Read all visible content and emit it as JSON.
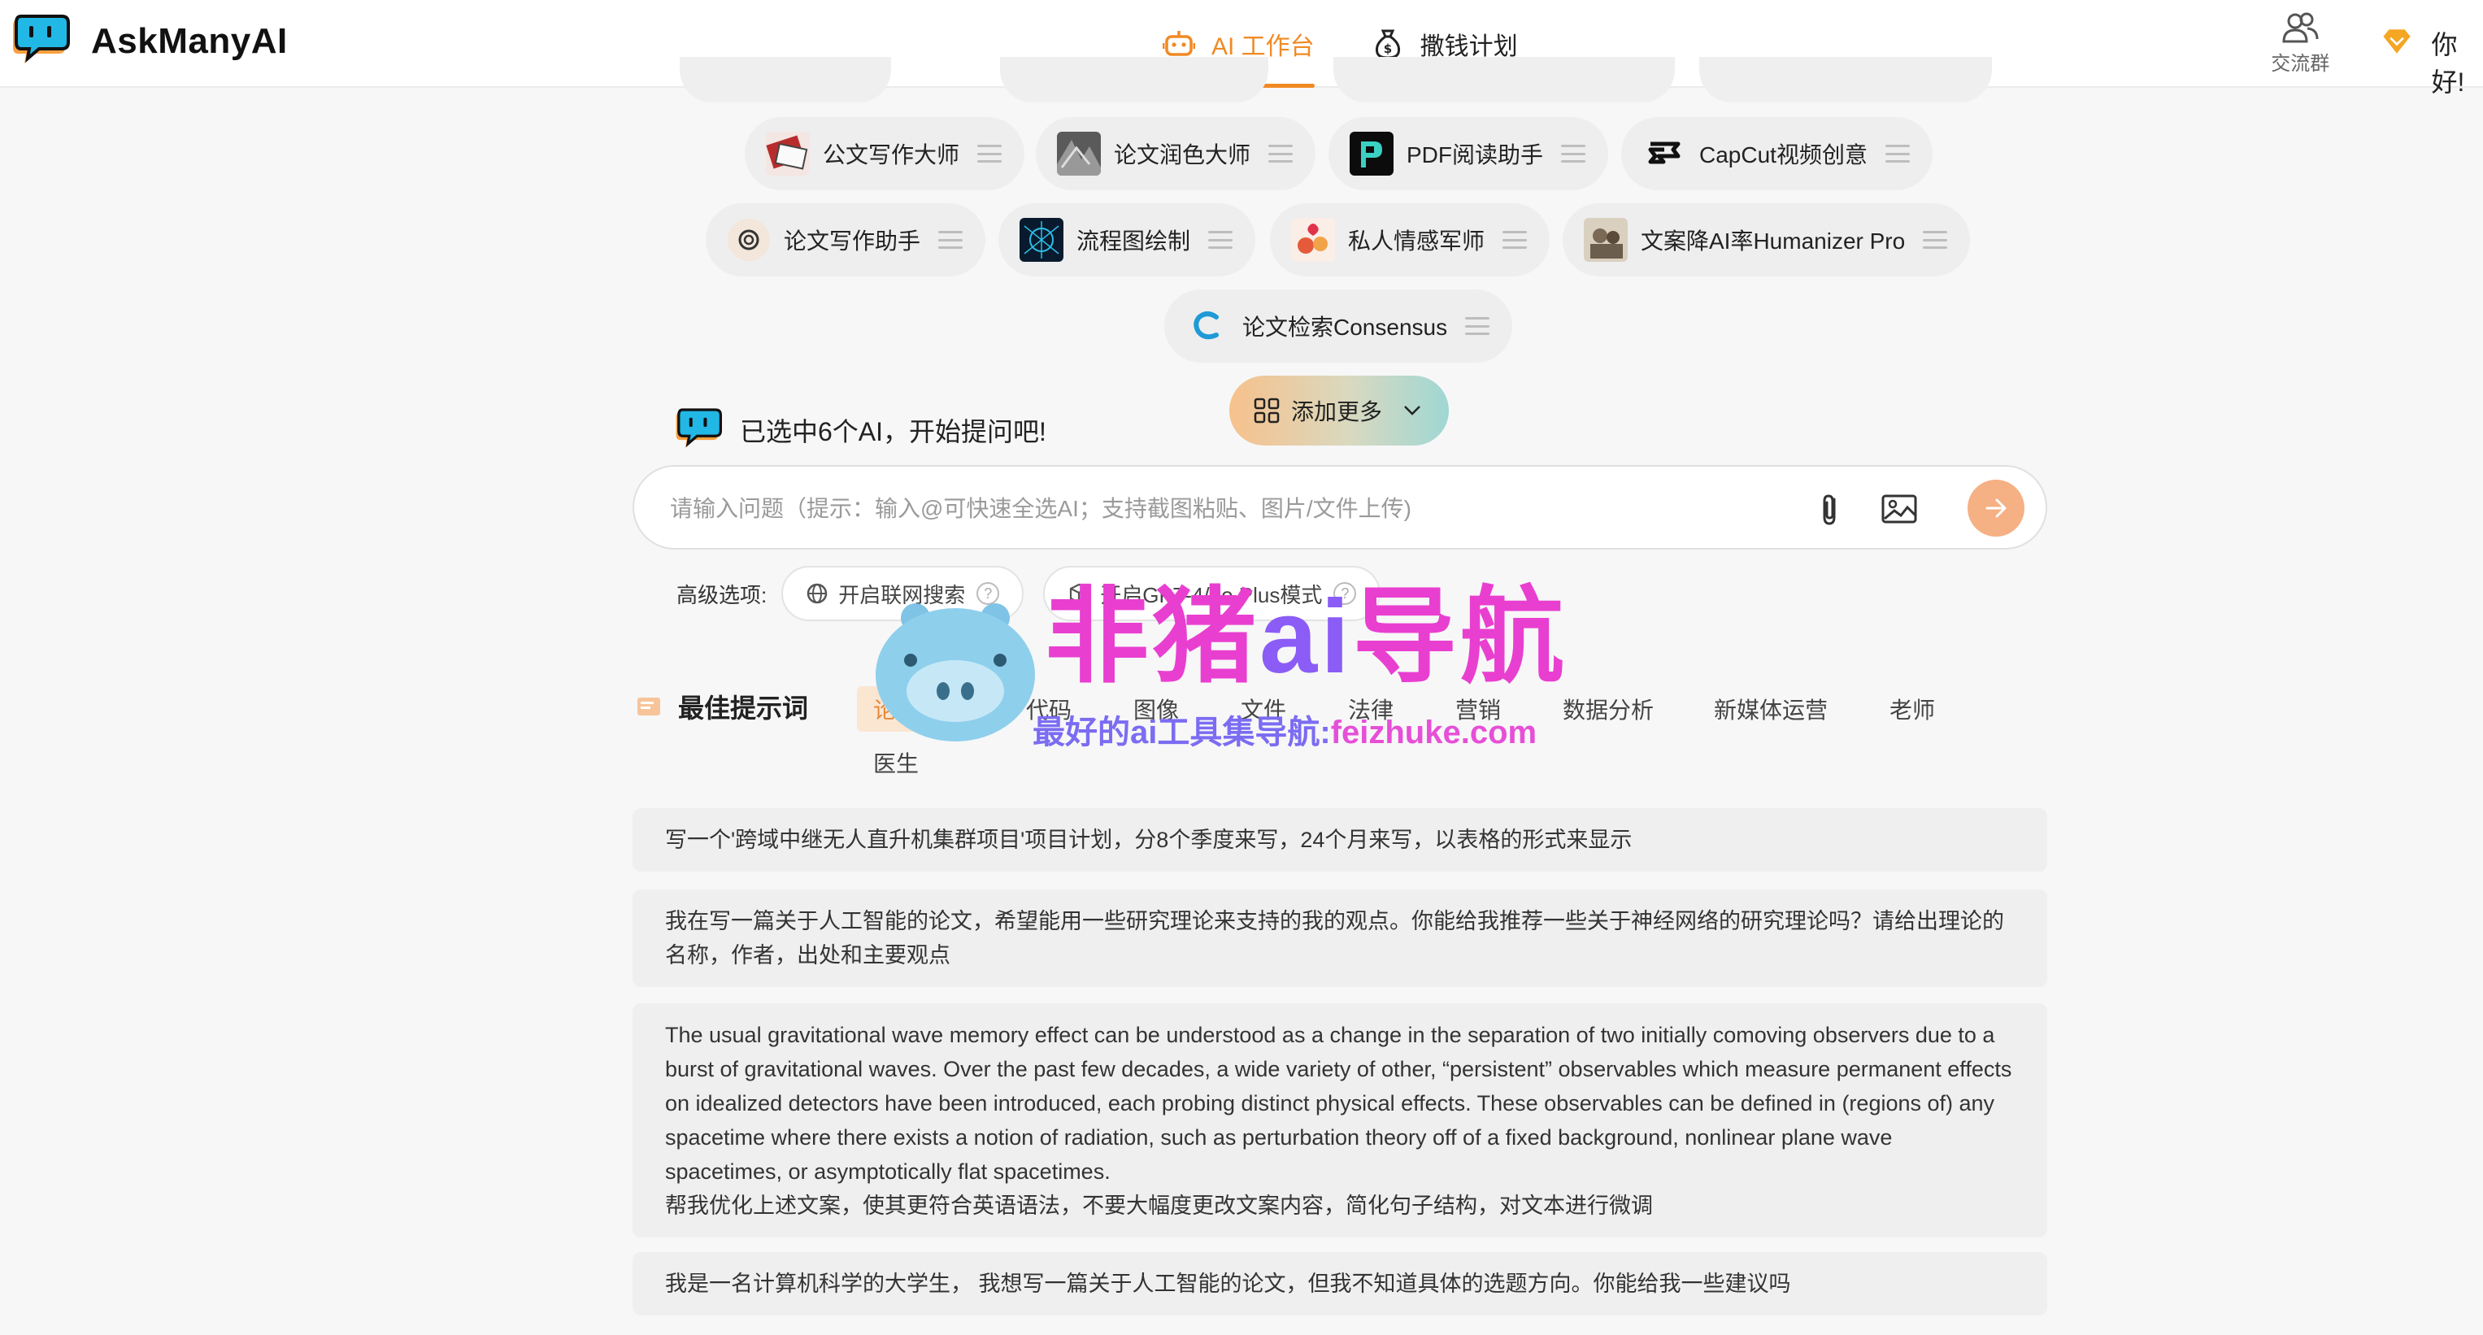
{
  "app": {
    "name": "AskManyAI"
  },
  "nav": {
    "tabs": [
      {
        "label": "AI 工作台",
        "icon": "robot-icon",
        "active": true
      },
      {
        "label": "撒钱计划",
        "icon": "money-bag-icon",
        "active": false
      }
    ]
  },
  "header_right": {
    "group_label": "交流群",
    "greeting": "你好!"
  },
  "ai_pills": [
    {
      "name": "公文写作大师"
    },
    {
      "name": "论文润色大师"
    },
    {
      "name": "PDF阅读助手"
    },
    {
      "name": "CapCut视频创意"
    },
    {
      "name": "论文写作助手"
    },
    {
      "name": "流程图绘制"
    },
    {
      "name": "私人情感军师"
    },
    {
      "name": "文案降AI率Humanizer Pro"
    },
    {
      "name": "论文检索Consensus"
    }
  ],
  "add_more_label": "添加更多",
  "selected_text": "已选中6个AI，开始提问吧!",
  "input": {
    "placeholder": "请输入问题（提示：输入@可快速全选AI；支持截图粘贴、图片/文件上传)",
    "value": ""
  },
  "advanced": {
    "label": "高级选项:",
    "web_search": "开启联网搜索",
    "gpt_plus": "开启GPT-4/4o Plus模式"
  },
  "prompts": {
    "title": "最佳提示词",
    "categories": [
      "论文科研",
      "代码",
      "图像",
      "文件",
      "法律",
      "营销",
      "数据分析",
      "新媒体运营",
      "老师",
      "医生"
    ],
    "active_category": "论文科研",
    "items": [
      "写一个'跨域中继无人直升机集群项目'项目计划，分8个季度来写，24个月来写，以表格的形式来显示",
      "我在写一篇关于人工智能的论文，希望能用一些研究理论来支持的我的观点。你能给我推荐一些关于神经网络的研究理论吗？请给出理论的名称，作者，出处和主要观点",
      "The usual gravitational wave memory effect can be understood as a change in the separation of two initially comoving observers due to a burst of gravitational waves. Over the past few decades, a wide variety of other, “persistent” observables which measure permanent effects on idealized detectors have been introduced, each probing distinct physical effects. These observables can be defined in (regions of) any spacetime where there exists a notion of radiation, such as perturbation theory off of a fixed background, nonlinear plane wave spacetimes, or asymptotically flat spacetimes.",
      "帮我优化上述文案，使其更符合英语语法，不要大幅度更改文案内容，简化句子结构，对文本进行微调",
      "我是一名计算机科学的大学生， 我想写一篇关于人工智能的论文，但我不知道具体的选题方向。你能给我一些建议吗"
    ]
  },
  "watermark": {
    "title_a": "非猪",
    "title_b": "ai",
    "title_c": "导航",
    "subtitle": "最好的ai工具集导航:",
    "site": "feizhuke.com"
  },
  "colors": {
    "accent": "#f08a24",
    "brand_blue": "#1f9ad6",
    "pill_bg": "#eeeeef"
  }
}
